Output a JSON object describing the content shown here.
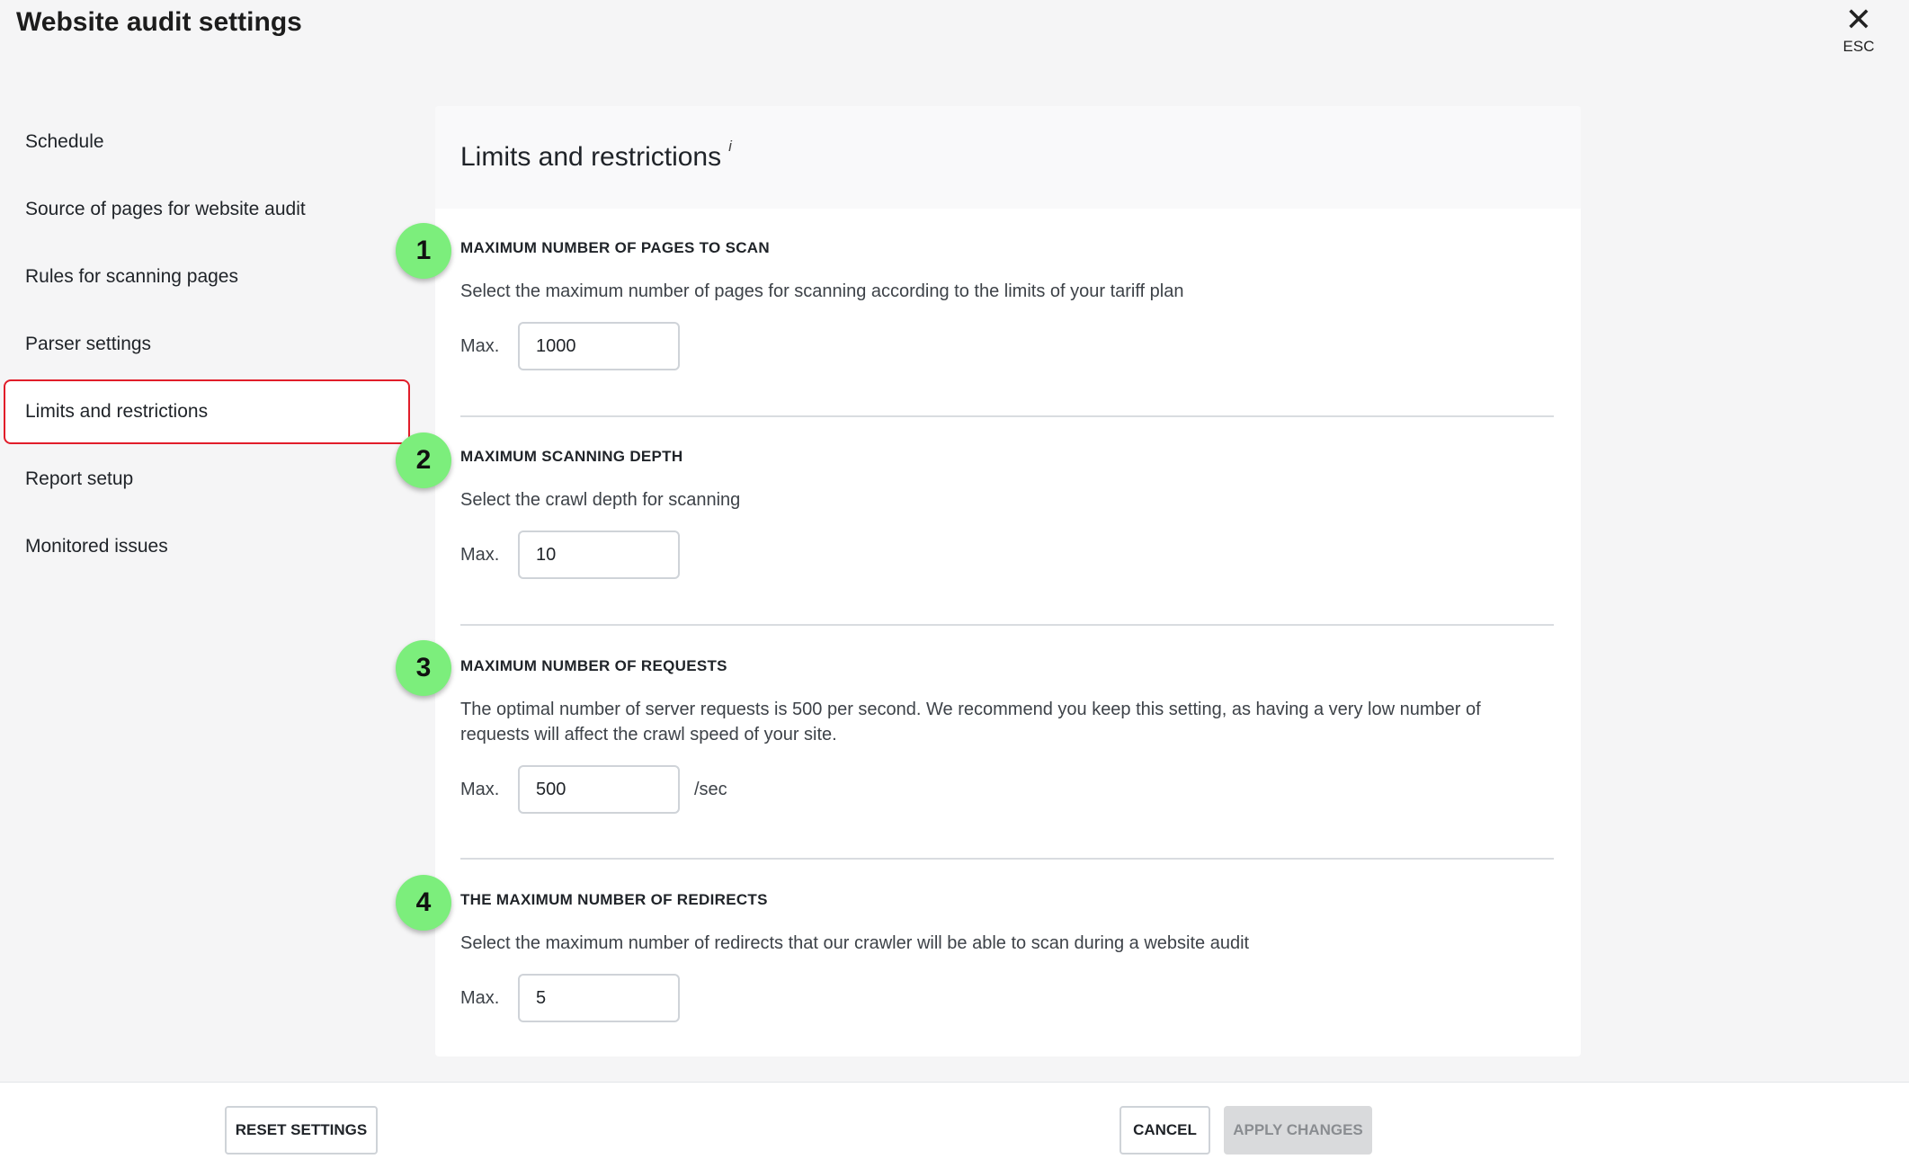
{
  "header": {
    "title": "Website audit settings",
    "close_symbol": "✕",
    "close_hint": "ESC"
  },
  "sidebar": {
    "items": [
      {
        "label": "Schedule"
      },
      {
        "label": "Source of pages for website audit"
      },
      {
        "label": "Rules for scanning pages"
      },
      {
        "label": "Parser settings"
      },
      {
        "label": "Limits and restrictions",
        "active": true
      },
      {
        "label": "Report setup"
      },
      {
        "label": "Monitored issues"
      }
    ]
  },
  "panel": {
    "title": "Limits and restrictions",
    "info_symbol": "i",
    "sections": [
      {
        "badge": "1",
        "title": "MAXIMUM NUMBER OF PAGES TO SCAN",
        "description": "Select the maximum number of pages for scanning according to the limits of your tariff plan",
        "max_label": "Max.",
        "value": "1000",
        "unit": ""
      },
      {
        "badge": "2",
        "title": "MAXIMUM SCANNING DEPTH",
        "description": "Select the crawl depth for scanning",
        "max_label": "Max.",
        "value": "10",
        "unit": ""
      },
      {
        "badge": "3",
        "title": "MAXIMUM NUMBER OF REQUESTS",
        "description": "The optimal number of server requests is 500 per second. We recommend you keep this setting, as having a very low number of requests will affect the crawl speed of your site.",
        "max_label": "Max.",
        "value": "500",
        "unit": "/sec"
      },
      {
        "badge": "4",
        "title": "THE MAXIMUM NUMBER OF REDIRECTS",
        "description": "Select the maximum number of redirects that our crawler will be able to scan during a website audit",
        "max_label": "Max.",
        "value": "5",
        "unit": ""
      }
    ]
  },
  "footer": {
    "reset_label": "RESET SETTINGS",
    "cancel_label": "CANCEL",
    "apply_label": "APPLY CHANGES"
  },
  "colors": {
    "active_border": "#e11d2a",
    "badge_green": "#7cee7c",
    "disabled_button": "#d9dadc"
  }
}
